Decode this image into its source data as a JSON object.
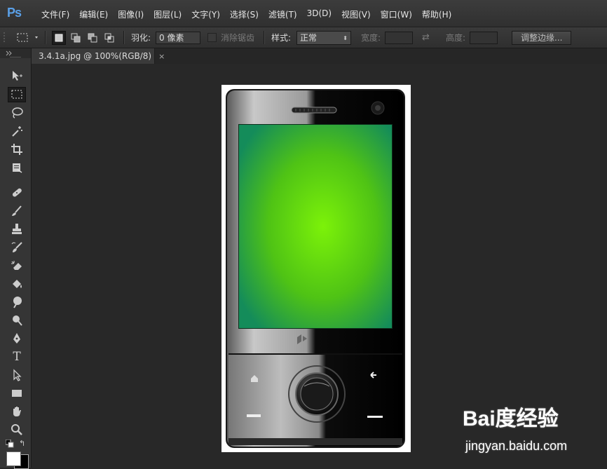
{
  "app": {
    "logo": "Ps"
  },
  "menu": [
    "文件(F)",
    "编辑(E)",
    "图像(I)",
    "图层(L)",
    "文字(Y)",
    "选择(S)",
    "滤镜(T)",
    "3D(D)",
    "视图(V)",
    "窗口(W)",
    "帮助(H)"
  ],
  "options": {
    "feather_label": "羽化:",
    "feather_value": "0 像素",
    "antialias_label": "消除锯齿",
    "style_label": "样式:",
    "style_value": "正常",
    "width_label": "宽度:",
    "height_label": "高度:",
    "refine_edge_label": "调整边缘..."
  },
  "document_tab": {
    "title": "3.4.1a.jpg @ 100%(RGB/8)",
    "close": "×"
  },
  "tools": [
    "move-tool-icon",
    "marquee-tool-icon",
    "lasso-tool-icon",
    "magic-wand-icon",
    "crop-tool-icon",
    "eyedropper-icon",
    "healing-brush-icon",
    "brush-tool-icon",
    "clone-stamp-icon",
    "history-brush-icon",
    "eraser-icon",
    "paint-bucket-icon",
    "blur-tool-icon",
    "dodge-tool-icon",
    "pen-tool-icon",
    "type-tool-icon",
    "path-selection-icon",
    "rectangle-tool-icon",
    "hand-tool-icon",
    "zoom-tool-icon"
  ],
  "type_tool_glyph": "T",
  "colors": {
    "accent": "#5aa0e8",
    "screen_center": "#7CF209",
    "screen_edge": "#148C5A",
    "foreground": "#ffffff",
    "background": "#000000"
  },
  "watermark": {
    "brand": "Bai度经验",
    "url": "jingyan.baidu.com"
  }
}
